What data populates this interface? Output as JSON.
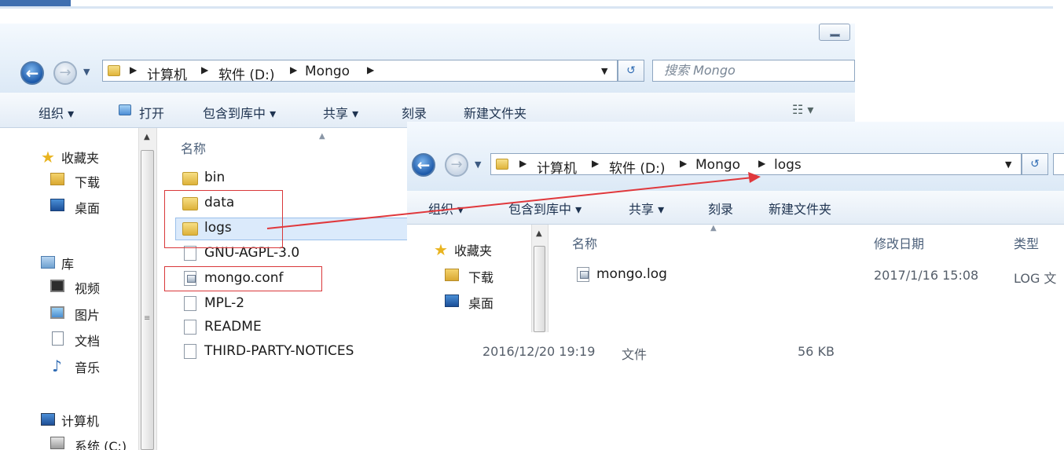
{
  "window_back": {
    "address": [
      "计算机",
      "软件 (D:)",
      "Mongo"
    ],
    "search_placeholder": "搜索 Mongo",
    "toolbar": {
      "organize": "组织 ▾",
      "open": "打开",
      "include": "包含到库中 ▾",
      "share": "共享 ▾",
      "burn": "刻录",
      "new_folder": "新建文件夹"
    },
    "nav": {
      "favorites": "收藏夹",
      "downloads": "下载",
      "desktop": "桌面",
      "libraries": "库",
      "videos": "视频",
      "pictures": "图片",
      "documents": "文档",
      "music": "音乐",
      "computer": "计算机",
      "system_c": "系统 (C:)"
    },
    "col_name": "名称",
    "files": [
      {
        "name": "bin",
        "type": "folder"
      },
      {
        "name": "data",
        "type": "folder"
      },
      {
        "name": "logs",
        "type": "folder"
      },
      {
        "name": "GNU-AGPL-3.0",
        "type": "file"
      },
      {
        "name": "mongo.conf",
        "type": "config"
      },
      {
        "name": "MPL-2",
        "type": "file"
      },
      {
        "name": "README",
        "type": "file"
      },
      {
        "name": "THIRD-PARTY-NOTICES",
        "type": "file",
        "date": "2016/12/20 19:19",
        "kind": "文件",
        "size": "56 KB"
      }
    ]
  },
  "window_front": {
    "address": [
      "计算机",
      "软件 (D:)",
      "Mongo",
      "logs"
    ],
    "toolbar": {
      "organize": "组织 ▾",
      "include": "包含到库中 ▾",
      "share": "共享 ▾",
      "burn": "刻录",
      "new_folder": "新建文件夹"
    },
    "nav": {
      "favorites": "收藏夹",
      "downloads": "下载",
      "desktop": "桌面"
    },
    "columns": {
      "name": "名称",
      "modified": "修改日期",
      "type": "类型"
    },
    "files": [
      {
        "name": "mongo.log",
        "date": "2017/1/16 15:08",
        "kind": "LOG 文"
      }
    ]
  },
  "colors": {
    "annotation_red": "#d9383a",
    "selection": "#dbeafb"
  }
}
